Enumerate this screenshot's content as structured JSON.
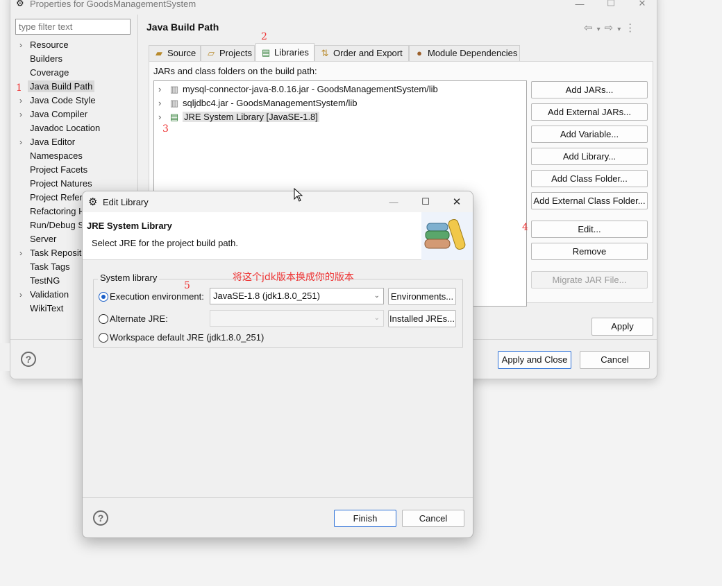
{
  "main_window": {
    "title": "Properties for GoodsManagementSystem",
    "filter_placeholder": "type filter text",
    "tree_items": [
      {
        "label": "Resource",
        "expandable": true
      },
      {
        "label": "Builders",
        "expandable": false
      },
      {
        "label": "Coverage",
        "expandable": false
      },
      {
        "label": "Java Build Path",
        "expandable": false,
        "selected": true
      },
      {
        "label": "Java Code Style",
        "expandable": true
      },
      {
        "label": "Java Compiler",
        "expandable": true
      },
      {
        "label": "Javadoc Location",
        "expandable": false
      },
      {
        "label": "Java Editor",
        "expandable": true
      },
      {
        "label": "Namespaces",
        "expandable": false
      },
      {
        "label": "Project Facets",
        "expandable": false
      },
      {
        "label": "Project Natures",
        "expandable": false
      },
      {
        "label": "Project Refere",
        "expandable": false
      },
      {
        "label": "Refactoring H",
        "expandable": false
      },
      {
        "label": "Run/Debug S",
        "expandable": false
      },
      {
        "label": "Server",
        "expandable": false
      },
      {
        "label": "Task Reposito",
        "expandable": true
      },
      {
        "label": "Task Tags",
        "expandable": false
      },
      {
        "label": "TestNG",
        "expandable": false
      },
      {
        "label": "Validation",
        "expandable": true
      },
      {
        "label": "WikiText",
        "expandable": false
      }
    ],
    "page_title": "Java Build Path",
    "tabs": [
      {
        "label": "Source",
        "icon": "source-folder-icon"
      },
      {
        "label": "Projects",
        "icon": "projects-folder-icon"
      },
      {
        "label": "Libraries",
        "icon": "libraries-icon",
        "active": true
      },
      {
        "label": "Order and Export",
        "icon": "order-export-icon"
      },
      {
        "label": "Module Dependencies",
        "icon": "module-icon"
      }
    ],
    "jars_label": "JARs and class folders on the build path:",
    "jars": [
      {
        "label": "mysql-connector-java-8.0.16.jar - GoodsManagementSystem/lib",
        "icon": "jar-icon"
      },
      {
        "label": "sqljdbc4.jar - GoodsManagementSystem/lib",
        "icon": "jar-icon"
      },
      {
        "label": "JRE System Library [JavaSE-1.8]",
        "icon": "library-icon",
        "selected": true
      }
    ],
    "side_buttons": [
      {
        "label": "Add JARs...",
        "enabled": true
      },
      {
        "label": "Add External JARs...",
        "enabled": true
      },
      {
        "label": "Add Variable...",
        "enabled": true
      },
      {
        "label": "Add Library...",
        "enabled": true
      },
      {
        "label": "Add Class Folder...",
        "enabled": true
      },
      {
        "label": "Add External Class Folder...",
        "enabled": true
      },
      {
        "label": "Edit...",
        "enabled": true
      },
      {
        "label": "Remove",
        "enabled": true
      },
      {
        "label": "Migrate JAR File...",
        "enabled": false
      }
    ],
    "apply_label": "Apply",
    "apply_close_label": "Apply and Close",
    "cancel_label": "Cancel",
    "help_symbol": "?"
  },
  "annotations": {
    "mark1": "1",
    "mark2": "2",
    "mark3": "3",
    "mark4": "4",
    "mark5": "5",
    "note": "将这个jdk版本换成你的版本"
  },
  "dialog": {
    "title": "Edit Library",
    "header_title": "JRE System Library",
    "header_desc": "Select JRE for the project build path.",
    "group_label": "System library",
    "exec_env_label": "Execution environment:",
    "exec_env_value": "JavaSE-1.8 (jdk1.8.0_251)",
    "environments_button": "Environments...",
    "alt_jre_label": "Alternate JRE:",
    "alt_jre_value": "",
    "installed_jres_button": "Installed JREs...",
    "workspace_default_label": "Workspace default JRE (jdk1.8.0_251)",
    "finish_label": "Finish",
    "cancel_label": "Cancel",
    "help_symbol": "?"
  }
}
